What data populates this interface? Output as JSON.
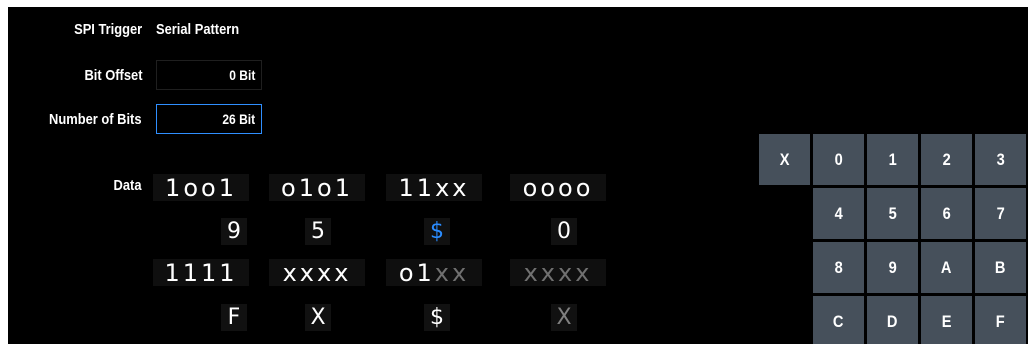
{
  "header": {
    "title": "SPI Trigger",
    "subtitle": "Serial Pattern"
  },
  "bit_offset": {
    "label": "Bit Offset",
    "value": "0 Bit"
  },
  "number_of_bits": {
    "label": "Number of Bits",
    "value": "26 Bit"
  },
  "data": {
    "label": "Data",
    "row1": {
      "nibbles": [
        {
          "chars": "1oo1",
          "dim_from": null
        },
        {
          "chars": "o1o1",
          "dim_from": null
        },
        {
          "chars": "11xx",
          "dim_from": null
        },
        {
          "chars": "oooo",
          "dim_from": null
        }
      ],
      "hex": [
        {
          "char": "9",
          "style": "normal"
        },
        {
          "char": "5",
          "style": "normal"
        },
        {
          "char": "$",
          "style": "blue"
        },
        {
          "char": "0",
          "style": "normal"
        }
      ]
    },
    "row2": {
      "nibbles": [
        {
          "chars": "1111",
          "dim_from": null
        },
        {
          "chars": "xxxx",
          "dim_from": null
        },
        {
          "chars": "o1xx",
          "dim_from": 2
        },
        {
          "chars": "xxxx",
          "dim_from": 0
        }
      ],
      "hex": [
        {
          "char": "F",
          "style": "normal"
        },
        {
          "char": "X",
          "style": "normal"
        },
        {
          "char": "$",
          "style": "normal"
        },
        {
          "char": "X",
          "style": "dim"
        }
      ]
    }
  },
  "keypad": {
    "rows": [
      [
        "X",
        "0",
        "1",
        "2",
        "3"
      ],
      [
        "",
        "4",
        "5",
        "6",
        "7"
      ],
      [
        "",
        "8",
        "9",
        "A",
        "B"
      ],
      [
        "",
        "C",
        "D",
        "E",
        "F"
      ]
    ]
  },
  "colors": {
    "background": "#000000",
    "key": "#46505b",
    "accent": "#2f8fff",
    "dim": "#707070"
  }
}
